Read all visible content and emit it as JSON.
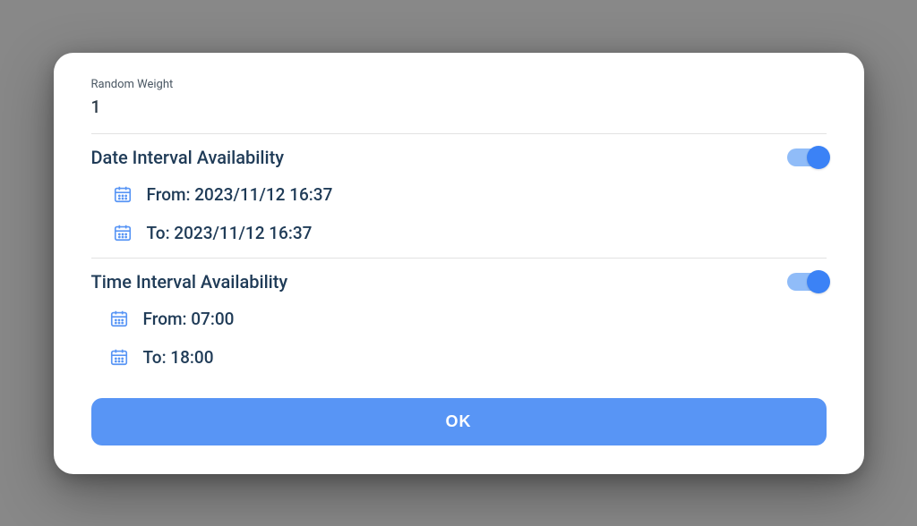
{
  "randomWeight": {
    "label": "Random Weight",
    "value": "1"
  },
  "dateInterval": {
    "title": "Date Interval Availability",
    "toggled": true,
    "from": {
      "text": "From: 2023/11/12 16:37"
    },
    "to": {
      "text": "To: 2023/11/12 16:37"
    }
  },
  "timeInterval": {
    "title": "Time Interval Availability",
    "toggled": true,
    "from": {
      "text": "From: 07:00"
    },
    "to": {
      "text": "To: 18:00"
    }
  },
  "okButton": "OK",
  "colors": {
    "accent": "#5895f5",
    "toggleTrack": "#90bcf8",
    "toggleKnob": "#3b82f6",
    "textDark": "#1f3b57"
  }
}
